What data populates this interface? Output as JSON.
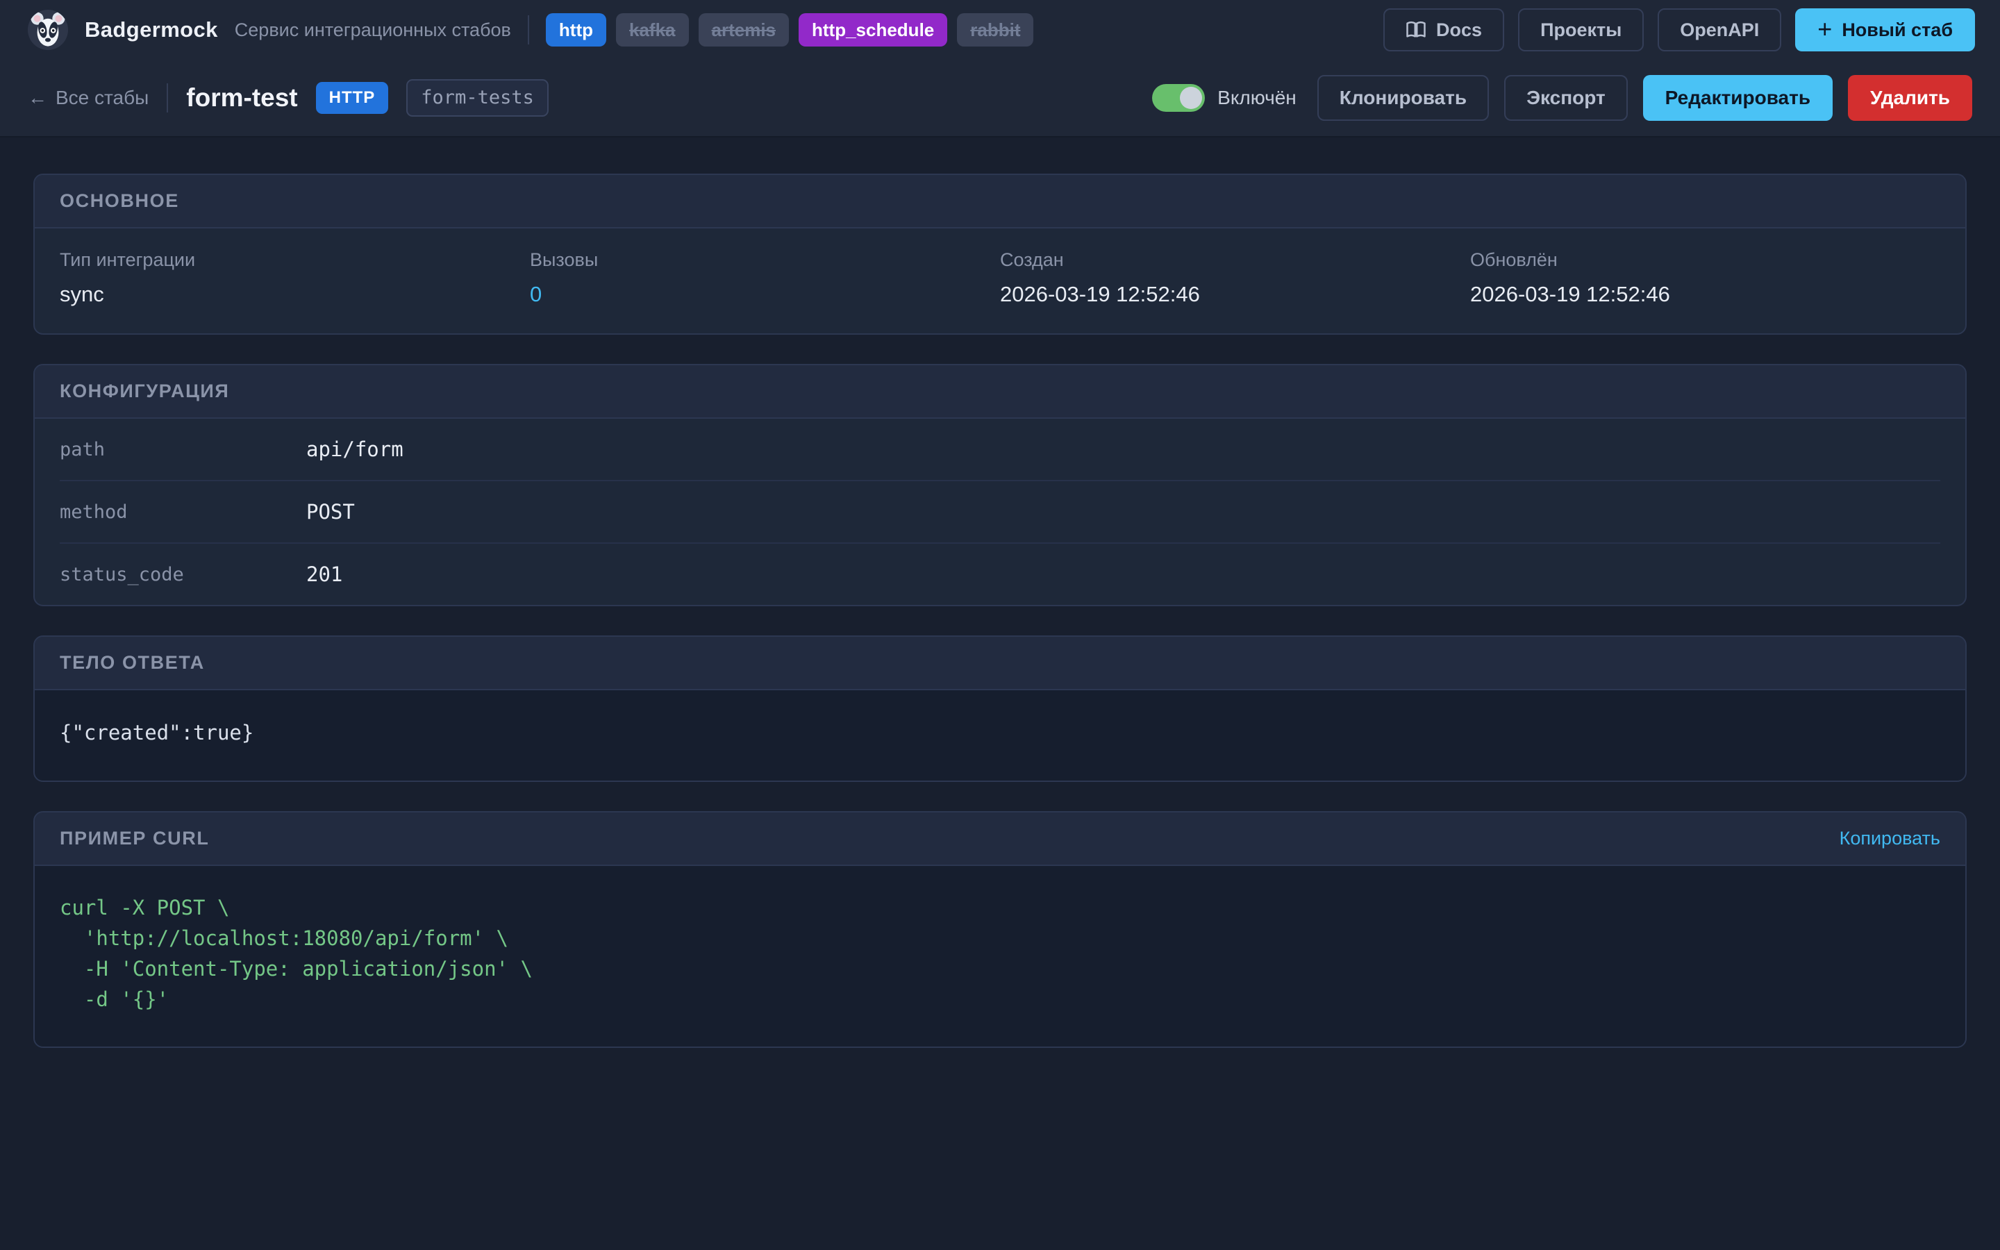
{
  "app": {
    "brand": "Badgermock",
    "subtitle": "Сервис интеграционных стабов"
  },
  "topbar": {
    "integration_tags": [
      {
        "label": "http",
        "style": "blue",
        "strike": false
      },
      {
        "label": "kafka",
        "style": "muted",
        "strike": true
      },
      {
        "label": "artemis",
        "style": "muted",
        "strike": true
      },
      {
        "label": "http_schedule",
        "style": "purple",
        "strike": false
      },
      {
        "label": "rabbit",
        "style": "muted",
        "strike": true
      }
    ],
    "buttons": {
      "docs": "Docs",
      "projects": "Проекты",
      "openapi": "OpenAPI",
      "new_stub_plus": "+",
      "new_stub": "Новый стаб"
    }
  },
  "stub_header": {
    "back_arrow": "←",
    "back_label": "Все стабы",
    "title": "form-test",
    "protocol_badge": "HTTP",
    "group_tag": "form-tests",
    "toggle_label": "Включён",
    "buttons": {
      "clone": "Клонировать",
      "export": "Экспорт",
      "edit": "Редактировать",
      "delete": "Удалить"
    }
  },
  "main_section": {
    "title": "ОСНОВНОЕ",
    "fields": [
      {
        "label": "Тип интеграции",
        "value": "sync"
      },
      {
        "label": "Вызовы",
        "value": "0"
      },
      {
        "label": "Создан",
        "value": "2026-03-19 12:52:46"
      },
      {
        "label": "Обновлён",
        "value": "2026-03-19 12:52:46"
      }
    ]
  },
  "config_section": {
    "title": "КОНФИГУРАЦИЯ",
    "rows": [
      {
        "key": "path",
        "value": "api/form"
      },
      {
        "key": "method",
        "value": "POST"
      },
      {
        "key": "status_code",
        "value": "201"
      }
    ]
  },
  "response_section": {
    "title": "ТЕЛО ОТВЕТА",
    "body": "{\"created\":true}"
  },
  "curl_section": {
    "title": "ПРИМЕР CURL",
    "copy_label": "Копировать",
    "code": "curl -X POST \\\n  'http://localhost:18080/api/form' \\\n  -H 'Content-Type: application/json' \\\n  -d '{}'"
  },
  "colors": {
    "accent_blue": "#2273dc",
    "accent_light_blue": "#4ac2f5",
    "accent_purple": "#9229c9",
    "toggle_green": "#68bf6c",
    "danger_red": "#d32f2f",
    "code_green": "#74c787"
  }
}
